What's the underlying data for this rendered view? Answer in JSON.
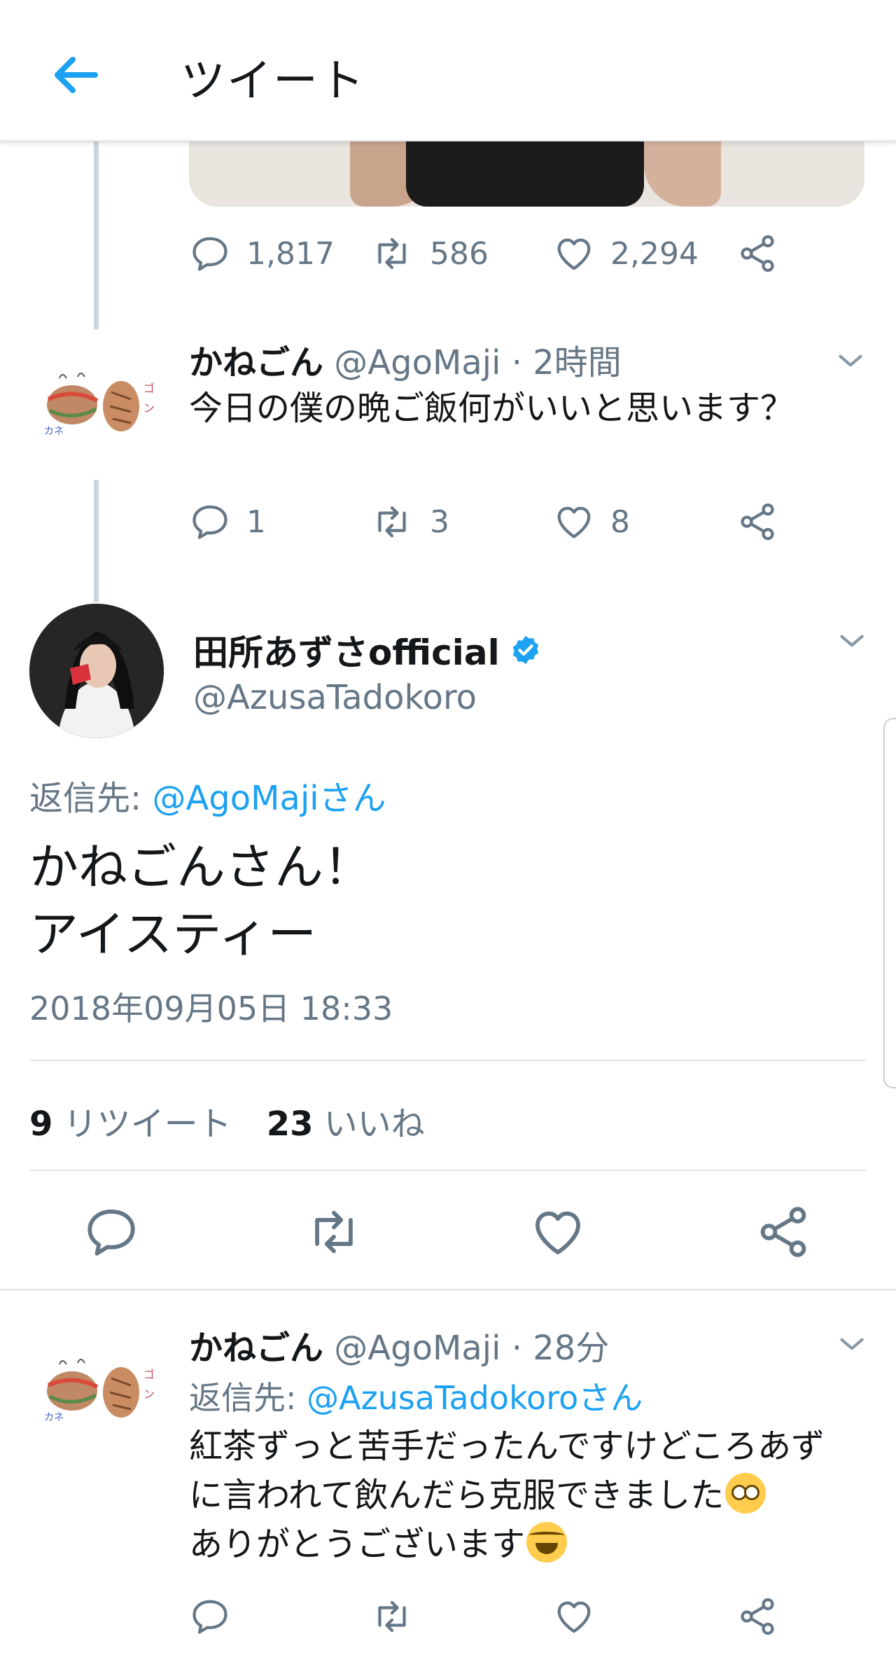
{
  "header": {
    "title": "ツイート"
  },
  "top_tweet": {
    "stats": {
      "replies": "1,817",
      "retweets": "586",
      "likes": "2,294"
    }
  },
  "tweet1": {
    "name": "かねごん",
    "handle": "@AgoMaji",
    "separator": "·",
    "time": "2時間",
    "text": "今日の僕の晩ご飯何がいいと思います？",
    "stats": {
      "replies": "1",
      "retweets": "3",
      "likes": "8"
    }
  },
  "main_tweet": {
    "name": "田所あずさofficial",
    "handle": "@AzusaTadokoro",
    "reply_prefix": "返信先: ",
    "reply_to": "@AgoMajiさん",
    "text_line1": "かねごんさん！",
    "text_line2": "アイスティー",
    "date": "2018年09月05日 18:33",
    "retweet_count": "9",
    "retweet_label": "リツイート",
    "like_count": "23",
    "like_label": "いいね"
  },
  "reply_tweet": {
    "name": "かねごん",
    "handle": "@AgoMaji",
    "separator": "·",
    "time": "28分",
    "reply_prefix": "返信先: ",
    "reply_to": "@AzusaTadokoroさん",
    "line1": "紅茶ずっと苦手だったんですけどころあず",
    "line2": "に言われて飲んだら克服できました",
    "line3": "ありがとうございます"
  },
  "icons": {
    "back": "arrow-left-icon",
    "reply": "comment-bubble-icon",
    "retweet": "retweet-icon",
    "like": "heart-icon",
    "share": "share-icon",
    "verified": "verified-badge-icon",
    "caret": "chevron-down-icon"
  },
  "colors": {
    "accent": "#1da1f2",
    "muted": "#657786",
    "text": "#14171a",
    "divider": "#e1e8ed"
  }
}
